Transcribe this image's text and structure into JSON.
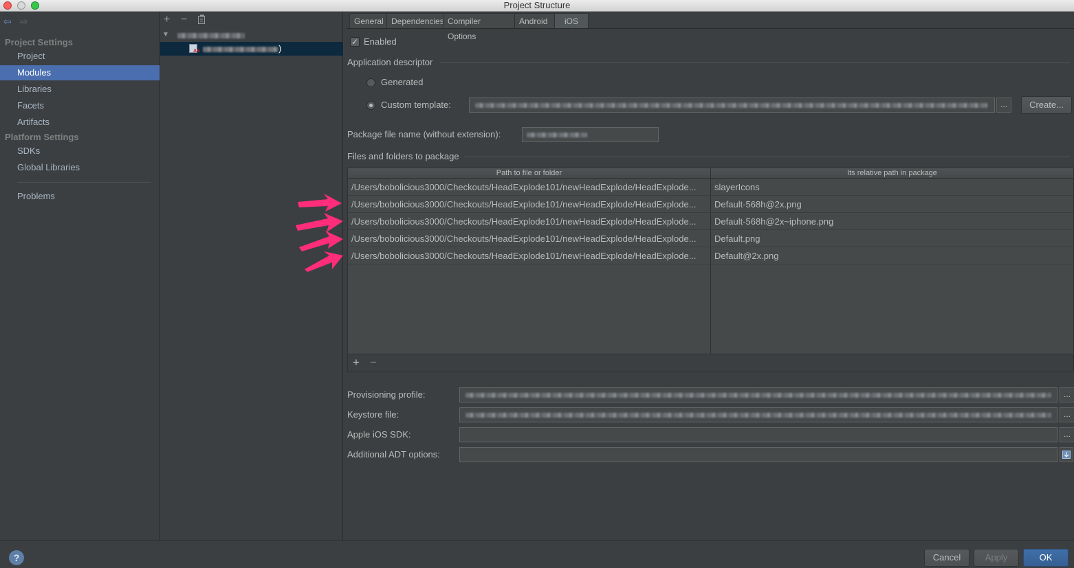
{
  "window": {
    "title": "Project Structure"
  },
  "colors": {
    "selection": "#4b6eaf",
    "background": "#3c3f41",
    "annotation_arrow": "#ff2d7a"
  },
  "sidebar": {
    "project_settings_header": "Project Settings",
    "project_items": [
      {
        "label": "Project",
        "selected": false
      },
      {
        "label": "Modules",
        "selected": true
      },
      {
        "label": "Libraries",
        "selected": false
      },
      {
        "label": "Facets",
        "selected": false
      },
      {
        "label": "Artifacts",
        "selected": false
      }
    ],
    "platform_settings_header": "Platform Settings",
    "platform_items": [
      {
        "label": "SDKs"
      },
      {
        "label": "Global Libraries"
      }
    ],
    "problems_label": "Problems"
  },
  "tree": {
    "toolbar": {
      "add": "+",
      "remove": "−",
      "copy_icon": "copy-icon"
    },
    "module_suffix": ")"
  },
  "tabs": [
    {
      "label": "General",
      "active": false
    },
    {
      "label": "Dependencies",
      "active": false
    },
    {
      "label": "Compiler Options",
      "active": false
    },
    {
      "label": "Android",
      "active": false
    },
    {
      "label": "iOS",
      "active": true
    }
  ],
  "ios": {
    "enabled_label": "Enabled",
    "enabled_checked": true,
    "app_descriptor_label": "Application descriptor",
    "generated_label": "Generated",
    "custom_template_label": "Custom template:",
    "custom_template_selected": true,
    "create_button": "Create...",
    "browse_button": "...",
    "package_file_label": "Package file name (without extension):",
    "files_label": "Files and folders to package",
    "table": {
      "headers": [
        "Path to file or folder",
        "Its relative path in package"
      ],
      "rows": [
        {
          "path": "/Users/bobolicious3000/Checkouts/HeadExplode101/newHeadExplode/HeadExplode...",
          "relative": "slayerIcons"
        },
        {
          "path": "/Users/bobolicious3000/Checkouts/HeadExplode101/newHeadExplode/HeadExplode...",
          "relative": "Default-568h@2x.png"
        },
        {
          "path": "/Users/bobolicious3000/Checkouts/HeadExplode101/newHeadExplode/HeadExplode...",
          "relative": "Default-568h@2x~iphone.png"
        },
        {
          "path": "/Users/bobolicious3000/Checkouts/HeadExplode101/newHeadExplode/HeadExplode...",
          "relative": "Default.png"
        },
        {
          "path": "/Users/bobolicious3000/Checkouts/HeadExplode101/newHeadExplode/HeadExplode...",
          "relative": "Default@2x.png"
        }
      ],
      "add": "+",
      "remove": "−"
    },
    "provisioning_label": "Provisioning profile:",
    "keystore_label": "Keystore file:",
    "sdk_label": "Apple iOS SDK:",
    "adt_label": "Additional ADT options:"
  },
  "footer": {
    "help": "?",
    "cancel": "Cancel",
    "apply": "Apply",
    "ok": "OK"
  }
}
